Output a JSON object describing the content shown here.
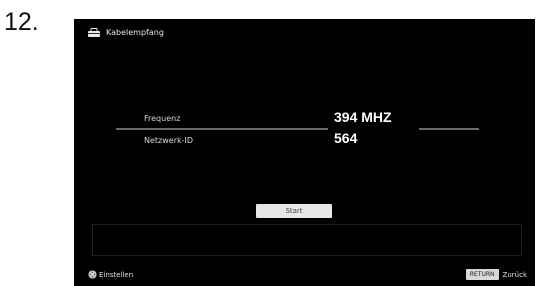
{
  "step_number": "12.",
  "screen": {
    "title": "Kabelempfang",
    "rows": [
      {
        "label": "Frequenz",
        "value": "394 MHZ"
      },
      {
        "label": "Netzwerk-ID",
        "value": "564"
      }
    ],
    "start_label": "Start",
    "footer": {
      "confirm_label": "Einstellen",
      "return_badge": "RETURN",
      "back_label": "Zurück"
    }
  },
  "icons": {
    "header": "tv-case-icon",
    "confirm": "dpad-icon"
  },
  "colors": {
    "screen_bg": "#000000",
    "value_text": "#ffffff",
    "button_bg": "#e6e6e6"
  }
}
